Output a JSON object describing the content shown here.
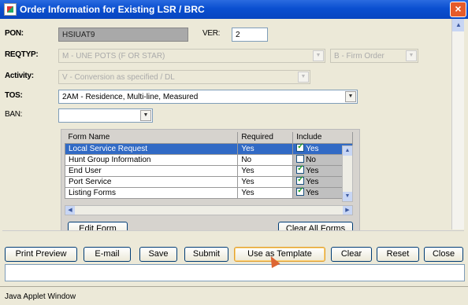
{
  "window": {
    "title": "Order Information for Existing LSR / BRC",
    "close_glyph": "×"
  },
  "fields": {
    "pon": {
      "label": "PON:",
      "value": "HSIUAT9"
    },
    "ver": {
      "label": "VER:",
      "value": "2"
    },
    "reqtyp": {
      "label": "REQTYP:",
      "value": "M - UNE POTS (F OR STAR)",
      "secondary": "B - Firm Order"
    },
    "activity": {
      "label": "Activity:",
      "value": "V - Conversion as specified / DL"
    },
    "tos": {
      "label": "TOS:",
      "value": "2AM - Residence, Multi-line, Measured"
    },
    "ban": {
      "label": "BAN:",
      "value": ""
    }
  },
  "forms_table": {
    "headers": [
      "Form Name",
      "Required",
      "Include"
    ],
    "rows": [
      {
        "name": "Local Service Request",
        "required": "Yes",
        "include": "Yes",
        "checked": true,
        "selected": true
      },
      {
        "name": "Hunt Group Information",
        "required": "No",
        "include": "No",
        "checked": false,
        "selected": false
      },
      {
        "name": "End User",
        "required": "Yes",
        "include": "Yes",
        "checked": true,
        "selected": false
      },
      {
        "name": "Port Service",
        "required": "Yes",
        "include": "Yes",
        "checked": true,
        "selected": false
      },
      {
        "name": "Listing Forms",
        "required": "Yes",
        "include": "Yes",
        "checked": true,
        "selected": false
      }
    ],
    "edit_form": "Edit Form",
    "clear_all": "Clear All Forms"
  },
  "buttons": {
    "print_preview": "Print Preview",
    "email": "E-mail",
    "save": "Save",
    "submit": "Submit",
    "use_as_template": "Use as Template",
    "clear": "Clear",
    "reset": "Reset",
    "close": "Close"
  },
  "status": "Java Applet Window",
  "colors": {
    "title_bar": "#0a4fd0",
    "selection": "#316ac5",
    "close_button": "#e55b2a"
  }
}
